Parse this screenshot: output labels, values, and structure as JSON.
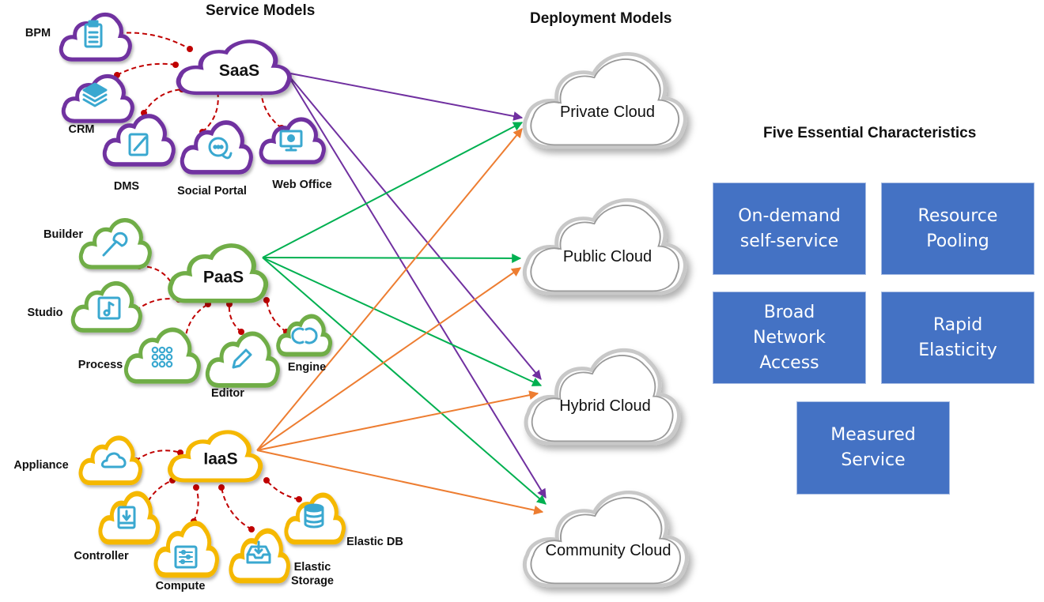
{
  "titles": {
    "service_models": "Service  Models",
    "deployment_models": "Deployment Models",
    "characteristics": "Five Essential Characteristics"
  },
  "colors": {
    "saas": "#7030a0",
    "paas": "#70ad47",
    "iaas": "#f5b800",
    "saas_arrow": "#7030a0",
    "paas_arrow": "#00b050",
    "iaas_arrow": "#ed7d31",
    "connector": "#c00000",
    "icon": "#3aa8d0",
    "char_box": "#4472c4"
  },
  "service_models": [
    {
      "id": "saas",
      "label": "SaaS",
      "children": [
        {
          "label": "BPM",
          "icon": "clipboard-icon"
        },
        {
          "label": "CRM",
          "icon": "layers-icon"
        },
        {
          "label": "DMS",
          "icon": "edit-document-icon"
        },
        {
          "label": "Social Portal",
          "icon": "chat-bubbles-icon"
        },
        {
          "label": "Web Office",
          "icon": "monitor-icon"
        }
      ],
      "targets": [
        "private",
        "hybrid",
        "community"
      ]
    },
    {
      "id": "paas",
      "label": "PaaS",
      "children": [
        {
          "label": "Builder",
          "icon": "wrench-icon"
        },
        {
          "label": "Studio",
          "icon": "music-note-icon"
        },
        {
          "label": "Process",
          "icon": "dot-grid-icon"
        },
        {
          "label": "Editor",
          "icon": "pencil-icon"
        },
        {
          "label": "Engine",
          "icon": "sync-icon"
        }
      ],
      "targets": [
        "private",
        "public",
        "hybrid",
        "community"
      ]
    },
    {
      "id": "iaas",
      "label": "IaaS",
      "children": [
        {
          "label": "Appliance",
          "icon": "cloud-icon"
        },
        {
          "label": "Controller",
          "icon": "download-box-icon"
        },
        {
          "label": "Compute",
          "icon": "sliders-icon"
        },
        {
          "label": "Elastic\nStorage",
          "icon": "inbox-download-icon"
        },
        {
          "label": "Elastic DB",
          "icon": "database-icon"
        }
      ],
      "targets": [
        "private",
        "public",
        "hybrid",
        "community"
      ]
    }
  ],
  "deployment_models": [
    {
      "id": "private",
      "label": "Private Cloud"
    },
    {
      "id": "public",
      "label": "Public Cloud"
    },
    {
      "id": "hybrid",
      "label": "Hybrid Cloud"
    },
    {
      "id": "community",
      "label": "Community Cloud"
    }
  ],
  "characteristics": [
    {
      "label": "On-demand\nself-service"
    },
    {
      "label": "Resource\nPooling"
    },
    {
      "label": "Broad\nNetwork\nAccess"
    },
    {
      "label": "Rapid\nElasticity"
    },
    {
      "label": "Measured\nService"
    }
  ]
}
